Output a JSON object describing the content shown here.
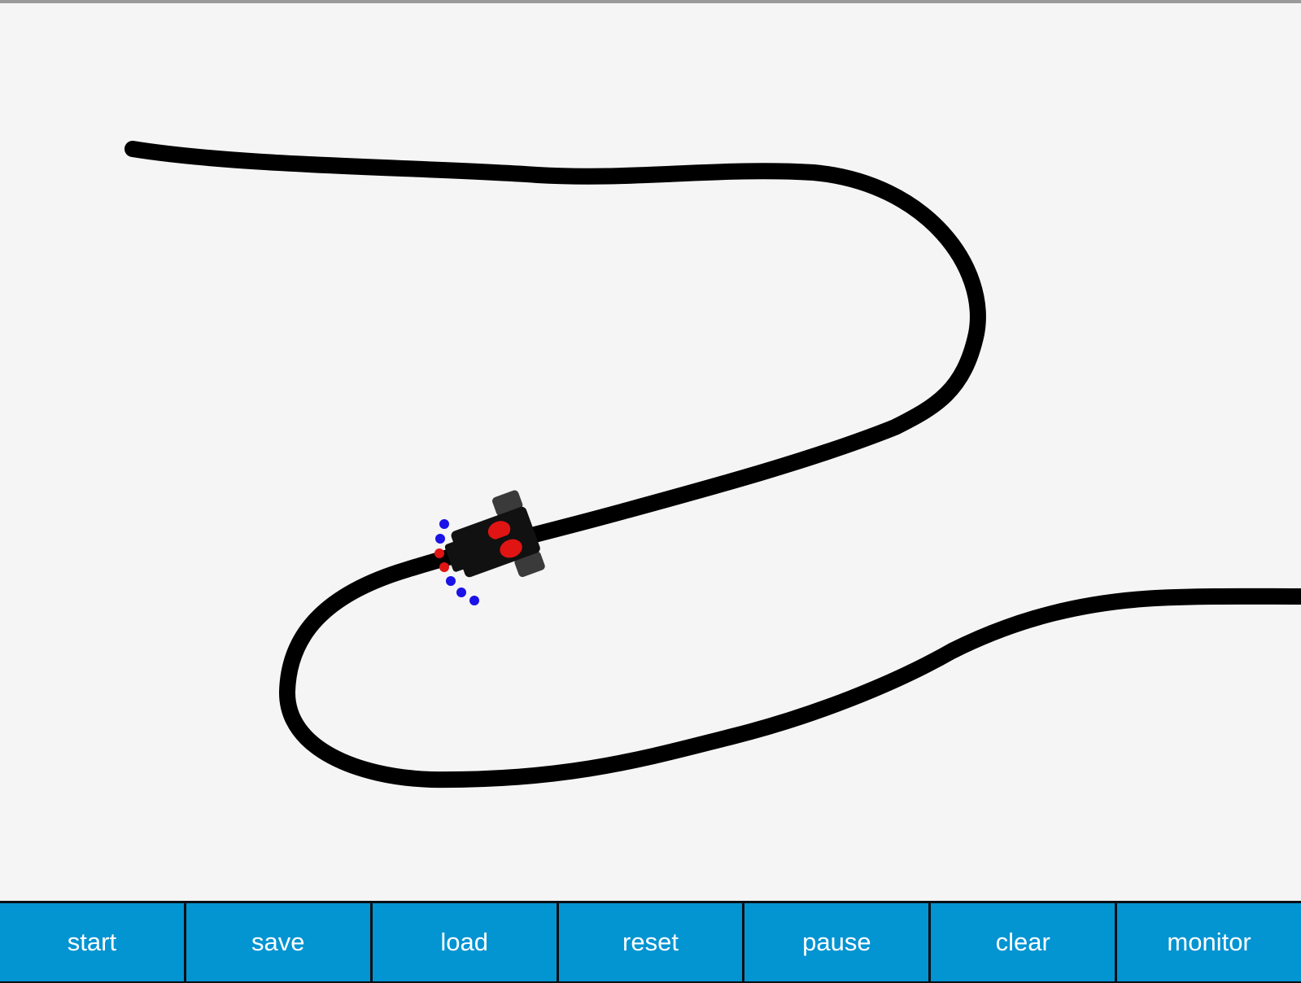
{
  "colors": {
    "background": "#f5f5f5",
    "track": "#000000",
    "toolbar_button": "#0394d2",
    "toolbar_text": "#ffffff",
    "sensor_blue": "#1a12e6",
    "sensor_red": "#e11414",
    "car_red": "#e11414",
    "car_body": "#111111"
  },
  "icons": {
    "car": "line-follower-robot-icon",
    "sensor": "sensor-dot-icon"
  },
  "toolbar": {
    "buttons": [
      {
        "id": "start",
        "label": "start"
      },
      {
        "id": "save",
        "label": "save"
      },
      {
        "id": "load",
        "label": "load"
      },
      {
        "id": "reset",
        "label": "reset"
      },
      {
        "id": "pause",
        "label": "pause"
      },
      {
        "id": "clear",
        "label": "clear"
      },
      {
        "id": "monitor",
        "label": "monitor"
      }
    ]
  }
}
